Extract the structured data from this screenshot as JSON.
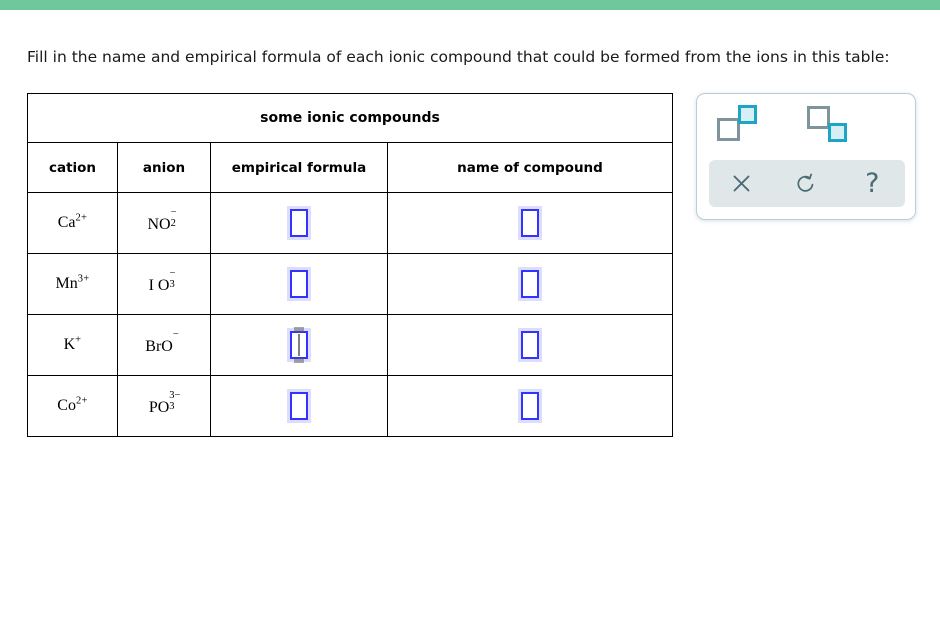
{
  "top_bar": {
    "color": "#6ec89b"
  },
  "instruction": {
    "text": "Fill in the name and empirical formula of each ionic compound that could be formed from the ions in this table:"
  },
  "table": {
    "title": "some ionic compounds",
    "columns": [
      "cation",
      "anion",
      "empirical formula",
      "name of compound"
    ],
    "rows": [
      {
        "cation": {
          "symbol": "Ca",
          "charge": "2+"
        },
        "anion": {
          "symbol": "NO",
          "subscript": "2",
          "charge": "−"
        },
        "empirical_formula": {
          "value": "",
          "focused": false
        },
        "name_of_compound": {
          "value": "",
          "focused": false
        }
      },
      {
        "cation": {
          "symbol": "Mn",
          "charge": "3+"
        },
        "anion": {
          "symbol": "I O",
          "subscript": "3",
          "charge": "−"
        },
        "empirical_formula": {
          "value": "",
          "focused": false
        },
        "name_of_compound": {
          "value": "",
          "focused": false
        }
      },
      {
        "cation": {
          "symbol": "K",
          "charge": "+"
        },
        "anion": {
          "symbol": "BrO",
          "subscript": "",
          "charge": "−"
        },
        "empirical_formula": {
          "value": "",
          "focused": true
        },
        "name_of_compound": {
          "value": "",
          "focused": false
        }
      },
      {
        "cation": {
          "symbol": "Co",
          "charge": "2+"
        },
        "anion": {
          "symbol": "PO",
          "subscript": "3",
          "charge": "3−"
        },
        "empirical_formula": {
          "value": "",
          "focused": false
        },
        "name_of_compound": {
          "value": "",
          "focused": false
        }
      }
    ]
  },
  "tool_palette": {
    "superscript_label": "superscript",
    "subscript_label": "subscript",
    "clear_label": "clear",
    "undo_label": "undo",
    "help_label": "help",
    "help_glyph": "?",
    "accent_color": "#1aa6c4",
    "gray_color": "#7d949d",
    "action_bg": "#dfe7e9"
  }
}
